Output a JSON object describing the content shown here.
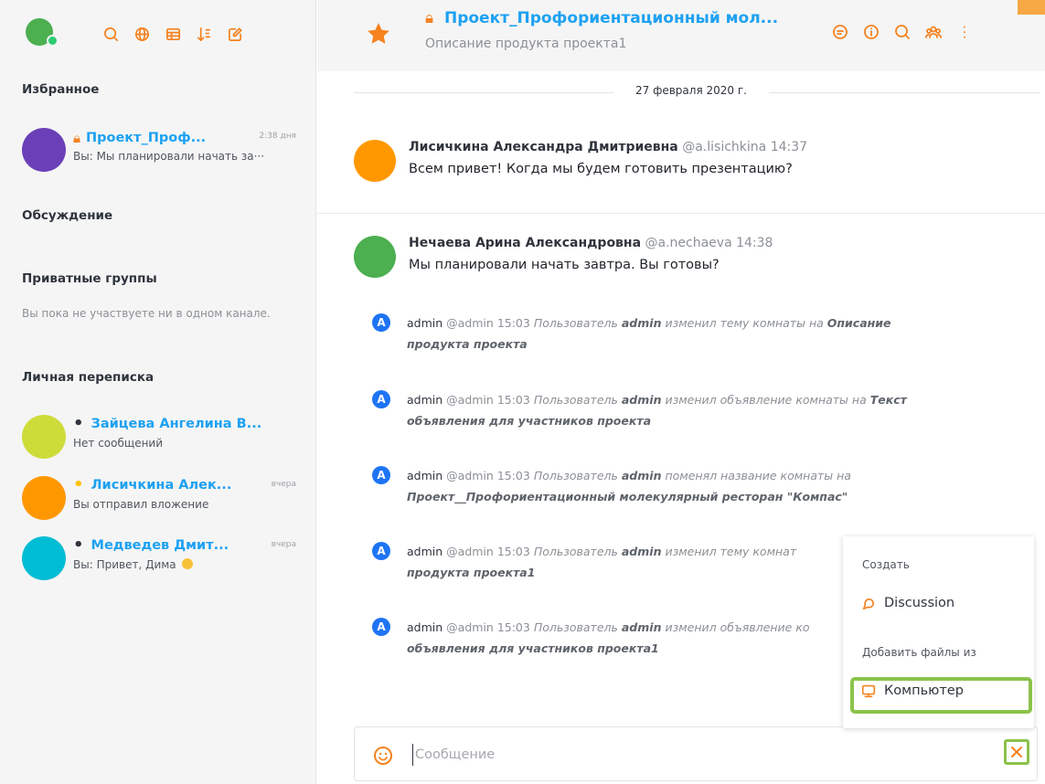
{
  "colors": {
    "accent": "#f5821f",
    "link": "#1da1f2",
    "highlight": "#8bc34a",
    "admin_badge": "#1d74f5"
  },
  "sidebar": {
    "icons": [
      "search-icon",
      "globe-icon",
      "table-icon",
      "sort-icon",
      "edit-icon"
    ],
    "favorites": {
      "title": "Избранное",
      "items": [
        {
          "name": "Проект_Проф...",
          "time": "2:38 дня",
          "last_message": "Вы: Мы планировали начать за···",
          "avatar_color": "#6a3fb8"
        }
      ]
    },
    "discussion": {
      "title": "Обсуждение"
    },
    "private_groups": {
      "title": "Приватные группы",
      "empty_text": "Вы пока не участвуете ни в одном канале."
    },
    "direct": {
      "title": "Личная переписка",
      "items": [
        {
          "name": "Зайцева Ангелина В...",
          "time": "",
          "last_message": "Нет сообщений",
          "avatar_color": "#cddc39",
          "status_color": "#2f343d"
        },
        {
          "name": "Лисичкина Алек...",
          "time": "вчера",
          "last_message": "Вы отправил вложение",
          "avatar_color": "#ff9800",
          "status_color": "#ffc107"
        },
        {
          "name": "Медведев Дмит...",
          "time": "вчера",
          "last_message": "Вы: Привет, Дима",
          "avatar_color": "#00bcd4",
          "status_color": "#2f343d"
        }
      ]
    }
  },
  "header": {
    "title": "Проект_Профориентационный мол...",
    "topic": "Описание продукта проекта1",
    "icons": [
      "discussion-icon",
      "info-icon",
      "search-icon",
      "members-icon",
      "kebab-menu-icon"
    ]
  },
  "date_divider": "27 февраля 2020 г.",
  "messages": [
    {
      "name": "Лисичкина Александра Дмитриевна",
      "username": "@a.lisichkina",
      "time": "14:37",
      "text": "Всем привет! Когда мы будем готовить презентацию?",
      "avatar_color": "#ff9800"
    },
    {
      "name": "Нечаева Арина Александровна",
      "username": "@a.nechaeva",
      "time": "14:38",
      "text": "Мы планировали начать завтра. Вы готовы?",
      "avatar_color": "#4caf50"
    }
  ],
  "system_messages": [
    {
      "badge": "A",
      "user": "admin",
      "username": "@admin",
      "time": "15:03",
      "pre": "Пользователь",
      "actor": "admin",
      "action": "изменил тему комнаты на",
      "value": "Описание продукта проекта"
    },
    {
      "badge": "A",
      "user": "admin",
      "username": "@admin",
      "time": "15:03",
      "pre": "Пользователь",
      "actor": "admin",
      "action": "изменил объявление комнаты на",
      "value": "Текст объявления для участников проекта"
    },
    {
      "badge": "A",
      "user": "admin",
      "username": "@admin",
      "time": "15:03",
      "pre": "Пользователь",
      "actor": "admin",
      "action": "поменял название комнаты на",
      "value": "Проект__Профориентационный молекулярный ресторан \"Компас\""
    },
    {
      "badge": "A",
      "user": "admin",
      "username": "@admin",
      "time": "15:03",
      "pre": "Пользователь",
      "actor": "admin",
      "action": "изменил тему комнат",
      "value": "продукта проекта1"
    },
    {
      "badge": "A",
      "user": "admin",
      "username": "@admin",
      "time": "15:03",
      "pre": "Пользователь",
      "actor": "admin",
      "action": "изменил объявление ко",
      "value": "объявления для участников проекта1"
    }
  ],
  "popup": {
    "create_title": "Создать",
    "discussion_label": "Discussion",
    "add_files_title": "Добавить файлы из",
    "computer_label": "Компьютер"
  },
  "composer": {
    "placeholder": "Сообщение"
  }
}
